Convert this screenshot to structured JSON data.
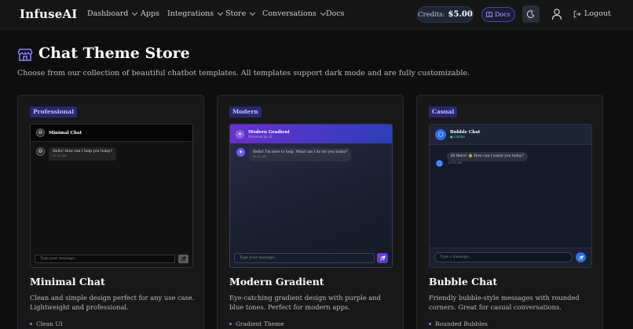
{
  "nav": {
    "brand": "InfuseAI",
    "items": [
      {
        "label": "Dashboard",
        "dropdown": true
      },
      {
        "label": "Apps",
        "dropdown": false
      },
      {
        "label": "Integrations",
        "dropdown": true
      },
      {
        "label": "Store",
        "dropdown": true
      },
      {
        "label": "Conversations",
        "dropdown": true
      },
      {
        "label": "Docs",
        "dropdown": false
      }
    ],
    "credits_label": "Credits:",
    "credits_value": "$5.00",
    "docs_button": "Docs",
    "logout_label": "Logout"
  },
  "header": {
    "title": "Chat Theme Store",
    "subtitle": "Choose from our collection of beautiful chatbot templates. All templates support dark mode and are fully customizable."
  },
  "cards": [
    {
      "badge": "Professional",
      "title": "Minimal Chat",
      "description": "Clean and simple design perfect for any use case. Lightweight and professional.",
      "feature": "Clean UI",
      "preview": {
        "bot_name": "Minimal Chat",
        "message": "Hello! How can I help you today?",
        "time": "03:51 AM",
        "input_placeholder": "Type your message..."
      }
    },
    {
      "badge": "Modern",
      "title": "Modern Gradient",
      "description": "Eye-catching gradient design with purple and blue tones. Perfect for modern apps.",
      "feature": "Gradient Theme",
      "preview": {
        "bot_name": "Modern Gradient",
        "bot_sub": "Powered by AI",
        "message": "Hello! I'm here to help. What can I do for you today?",
        "time": "03:51 AM",
        "input_placeholder": "Type your message..."
      }
    },
    {
      "badge": "Casual",
      "title": "Bubble Chat",
      "description": "Friendly bubble-style messages with rounded corners. Great for casual conversations.",
      "feature": "Rounded Bubbles",
      "preview": {
        "bot_name": "Bubble Chat",
        "status": "● Online",
        "message": "Hi there! 👋 How can I assist you today?",
        "time": "03:51 AM",
        "input_placeholder": "Type a message..."
      }
    }
  ],
  "colors": {
    "background": "#0e0e0e",
    "card": "#181818",
    "accent": "#6d63ff",
    "badge": "#2a2870"
  },
  "icons": [
    "store-icon",
    "moon-icon",
    "user-icon",
    "logout-icon",
    "book-icon",
    "send-icon",
    "chevron-down-icon"
  ]
}
